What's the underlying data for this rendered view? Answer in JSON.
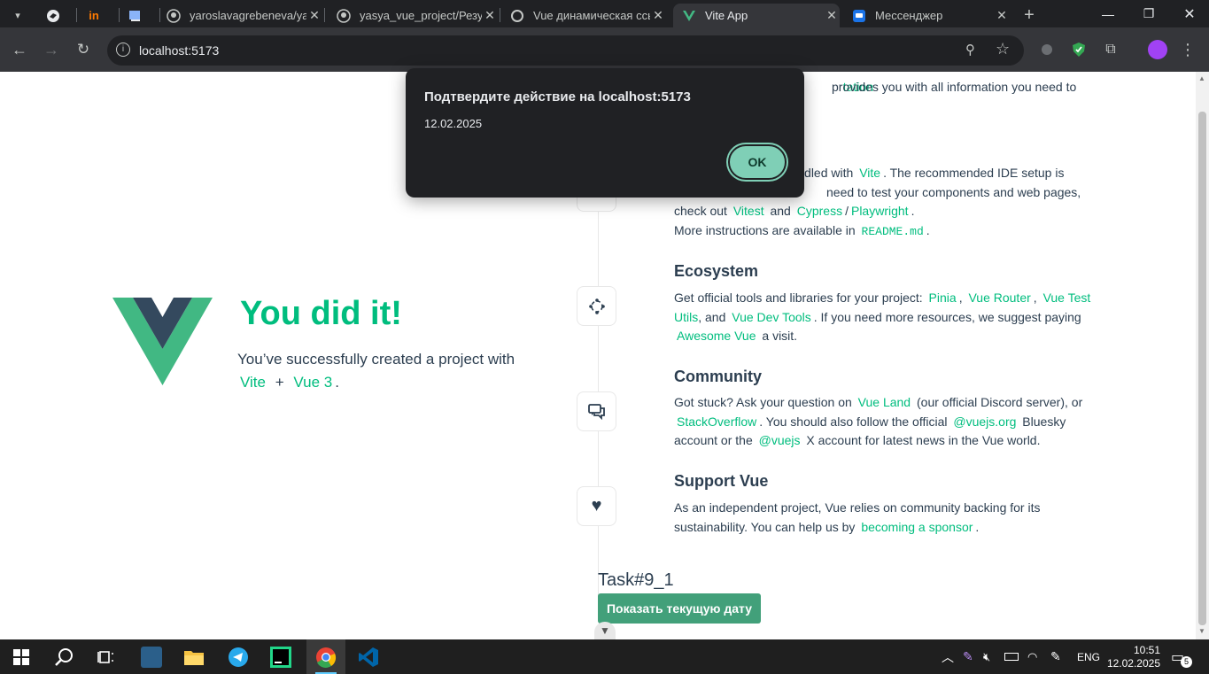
{
  "browser": {
    "tabs": [
      {
        "title": "",
        "icon": "spiral-icon"
      },
      {
        "title": "",
        "icon": "in-logo-icon"
      },
      {
        "title": "",
        "icon": "book-icon"
      },
      {
        "title": "yaroslavagrebeneva/ya",
        "icon": "github-icon"
      },
      {
        "title": "yasya_vue_project/Резу",
        "icon": "github-icon"
      },
      {
        "title": "Vue динамическая ссы",
        "icon": "chatgpt-icon"
      },
      {
        "title": "Vite App",
        "icon": "vue-icon",
        "active": true
      },
      {
        "title": "Мессенджер",
        "icon": "chat-icon"
      }
    ],
    "url": "localhost:5173"
  },
  "page": {
    "hero": {
      "title": "You did it!",
      "subtitle_1": "You’ve successfully created a project with",
      "link_vite": "Vite",
      "plus": "+",
      "link_vue3": "Vue 3",
      "dot": "."
    },
    "documentation": {
      "line_1_link": "tation",
      "line_1_text": "provides you with all information you need to"
    },
    "tooling": {
      "line_1_text": "d bundled with",
      "line_1_link": "Vite",
      "line_1_tail": ". The recommended IDE setup is",
      "line_2_text": "need to test your components and web pages,",
      "line_3_text": "check out",
      "link_vitest": "Vitest",
      "and": "and",
      "link_cypress": "Cypress",
      "slash": "/",
      "link_playwright": "Playwright",
      "dot": ".",
      "line_4_text": "More instructions are available in",
      "link_readme": "README.md",
      "dot2": "."
    },
    "ecosystem": {
      "heading": "Ecosystem",
      "text_1": "Get official tools and libraries for your project:",
      "link_pinia": "Pinia",
      "link_router": "Vue Router",
      "link_test": "Vue Test",
      "link_test_2": "Utils",
      "text_and": ", and",
      "link_devtools": "Vue Dev Tools",
      "text_2": ". If you need more resources, we suggest paying",
      "link_awesome": "Awesome Vue",
      "text_3": "a visit."
    },
    "community": {
      "heading": "Community",
      "text_1": "Got stuck? Ask your question on",
      "link_land": "Vue Land",
      "text_2": "(our official Discord server), or",
      "link_so": "StackOverflow",
      "text_3": ". You should also follow the official",
      "link_vuejsorg": "@vuejs.org",
      "text_4": "Bluesky",
      "text_5": "account or the",
      "link_vuejs": "@vuejs",
      "text_6": "X account for latest news in the Vue world."
    },
    "support": {
      "heading": "Support Vue",
      "text_1": "As an independent project, Vue relies on community backing for its",
      "text_2": "sustainability. You can help us by",
      "link_sponsor": "becoming a sponsor",
      "dot": "."
    },
    "task": {
      "label": "Task#9_1",
      "button": "Показать текущую дату"
    }
  },
  "dialog": {
    "title": "Подтвердите действие на localhost:5173",
    "message": "12.02.2025",
    "ok": "OK"
  },
  "taskbar": {
    "lang": "ENG",
    "time": "10:51",
    "date": "12.02.2025",
    "notifications": "5"
  },
  "colors": {
    "accent": "#00bd7e",
    "text": "#2c3e50",
    "button": "#42a07a"
  }
}
